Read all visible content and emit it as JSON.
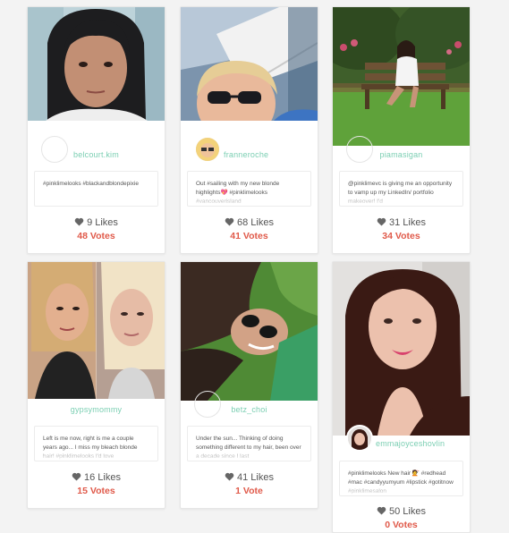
{
  "posts": [
    {
      "username": "belcourt.kim",
      "caption": "#pinklimelooks #blackandblondepixie",
      "likes": "9 Likes",
      "votes": "48 Votes"
    },
    {
      "username": "franneroche",
      "caption": "Out #sailing with my new blonde highlights💖 #pinklimelooks #vancouverisland",
      "likes": "68 Likes",
      "votes": "41 Votes"
    },
    {
      "username": "piamasigan",
      "caption": "@pinklimevc is giving me an opportunity to vamp up my LinkedIn/ portfolio makeover! I'd",
      "likes": "31 Likes",
      "votes": "34 Votes"
    },
    {
      "username": "gypsymommy",
      "caption": "Left is me now, right is me a couple years ago... I miss my bleach blonde hair! #pinklimelooks I'd love",
      "likes": "16 Likes",
      "votes": "15 Votes"
    },
    {
      "username": "betz_choi",
      "caption": "Under the sun... Thinking of doing something different to my hair, been over a decade since I last",
      "likes": "41 Likes",
      "votes": "1 Vote"
    },
    {
      "username": "emmajoyceshovlin",
      "caption": "#pinklimelooks New hair 💇 #redhead #mac #candyyumyum #lipstick #gotitnow #pinklimesalon",
      "likes": "50 Likes",
      "votes": "0 Votes"
    }
  ],
  "colors": {
    "username": "#7ccfb3",
    "votes": "#e05a4a",
    "likes": "#555555"
  },
  "icons": {
    "like": "heart-icon"
  }
}
